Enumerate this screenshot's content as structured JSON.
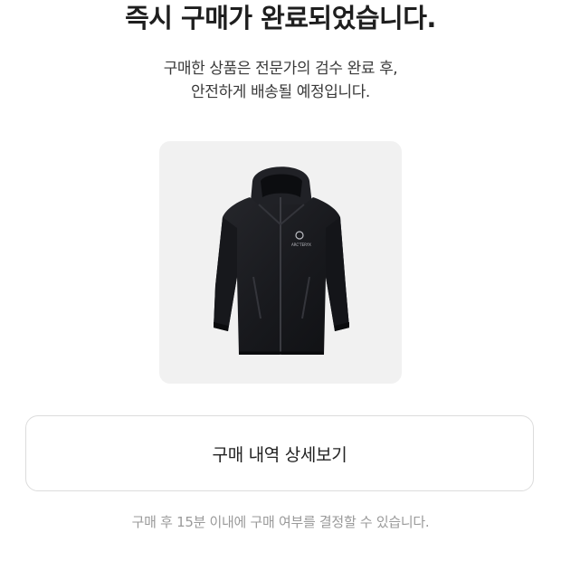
{
  "header": {
    "title": "즉시 구매가 완료되었습니다.",
    "subtitle_line1": "구매한 상품은 전문가의 검수 완료 후,",
    "subtitle_line2": "안전하게 배송될 예정입니다."
  },
  "product": {
    "image_kind": "black-hooded-jacket",
    "logo_text": "ARC'TERYX",
    "background_color": "#f1f1f1",
    "jacket_color": "#1b1c20"
  },
  "actions": {
    "detail_button_label": "구매 내역 상세보기"
  },
  "footer": {
    "notice": "구매 후 15분 이내에 구매 여부를 결정할 수 있습니다."
  }
}
